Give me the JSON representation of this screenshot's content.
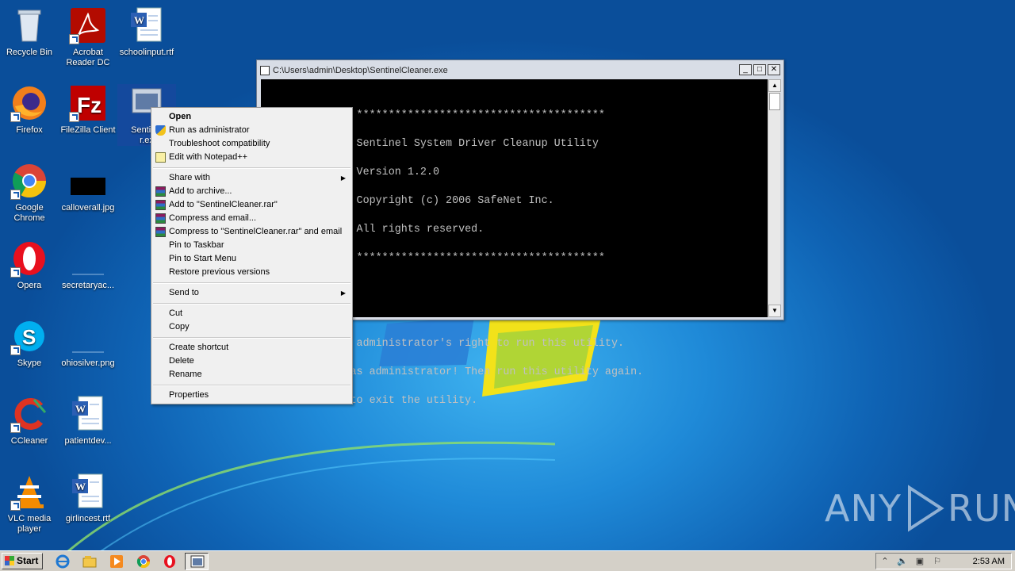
{
  "desktop": {
    "icons": [
      {
        "label": "Recycle Bin",
        "icon": "recycle-bin-icon"
      },
      {
        "label": "Acrobat\nReader DC",
        "icon": "acrobat-icon"
      },
      {
        "label": "schoolinput.rtf",
        "icon": "word-doc-icon"
      },
      {
        "label": "Firefox",
        "icon": "firefox-icon"
      },
      {
        "label": "FileZilla Client",
        "icon": "filezilla-icon"
      },
      {
        "label": "Sentinel",
        "label2": "r.ex",
        "icon": "console-app-icon"
      },
      {
        "label": "Google\nChrome",
        "icon": "chrome-icon"
      },
      {
        "label": "calloverall.jpg",
        "icon": "image-file-icon"
      },
      {
        "label": "Opera",
        "icon": "opera-icon"
      },
      {
        "label": "secretaryac...",
        "icon": "blank-file-icon"
      },
      {
        "label": "Skype",
        "icon": "skype-icon"
      },
      {
        "label": "ohiosilver.png",
        "icon": "blank-file-icon"
      },
      {
        "label": "CCleaner",
        "icon": "ccleaner-icon"
      },
      {
        "label": "patientdev...",
        "icon": "word-doc-icon"
      },
      {
        "label": "VLC media\nplayer",
        "icon": "vlc-icon"
      },
      {
        "label": "girlincest.rtf",
        "icon": "word-doc-icon"
      }
    ]
  },
  "console": {
    "title": "C:\\Users\\admin\\Desktop\\SentinelCleaner.exe",
    "lines": [
      "               ***************************************",
      "               Sentinel System Driver Cleanup Utility",
      "               Version 1.2.0",
      "               Copyright (c) 2006 SafeNet Inc.",
      "               All rights reserved.",
      "               ***************************************",
      "",
      "",
      "               administrator's right to run this utility.",
      "              as administrator! Then run this utility again.",
      "              to exit the utility."
    ]
  },
  "context_menu": {
    "items": [
      {
        "label": "Open",
        "bold": true
      },
      {
        "label": "Run as administrator",
        "icon": "uac-shield-icon"
      },
      {
        "label": "Troubleshoot compatibility"
      },
      {
        "label": "Edit with Notepad++",
        "icon": "notepadpp-icon"
      },
      {
        "label": "Share with",
        "submenu": true
      },
      {
        "label": "Add to archive...",
        "icon": "winrar-icon"
      },
      {
        "label": "Add to \"SentinelCleaner.rar\"",
        "icon": "winrar-icon"
      },
      {
        "label": "Compress and email...",
        "icon": "winrar-icon"
      },
      {
        "label": "Compress to \"SentinelCleaner.rar\" and email",
        "icon": "winrar-icon"
      },
      {
        "label": "Pin to Taskbar"
      },
      {
        "label": "Pin to Start Menu"
      },
      {
        "label": "Restore previous versions"
      },
      {
        "label": "Send to",
        "submenu": true
      },
      {
        "label": "Cut"
      },
      {
        "label": "Copy"
      },
      {
        "label": "Create shortcut"
      },
      {
        "label": "Delete"
      },
      {
        "label": "Rename"
      },
      {
        "label": "Properties"
      }
    ]
  },
  "taskbar": {
    "start_label": "Start",
    "pinned": [
      "ie-icon",
      "explorer-icon",
      "media-player-icon",
      "chrome-icon",
      "opera-icon",
      "console-app-icon"
    ],
    "clock": "2:53 AM"
  },
  "watermark": {
    "left": "ANY",
    "right": "RUN"
  }
}
